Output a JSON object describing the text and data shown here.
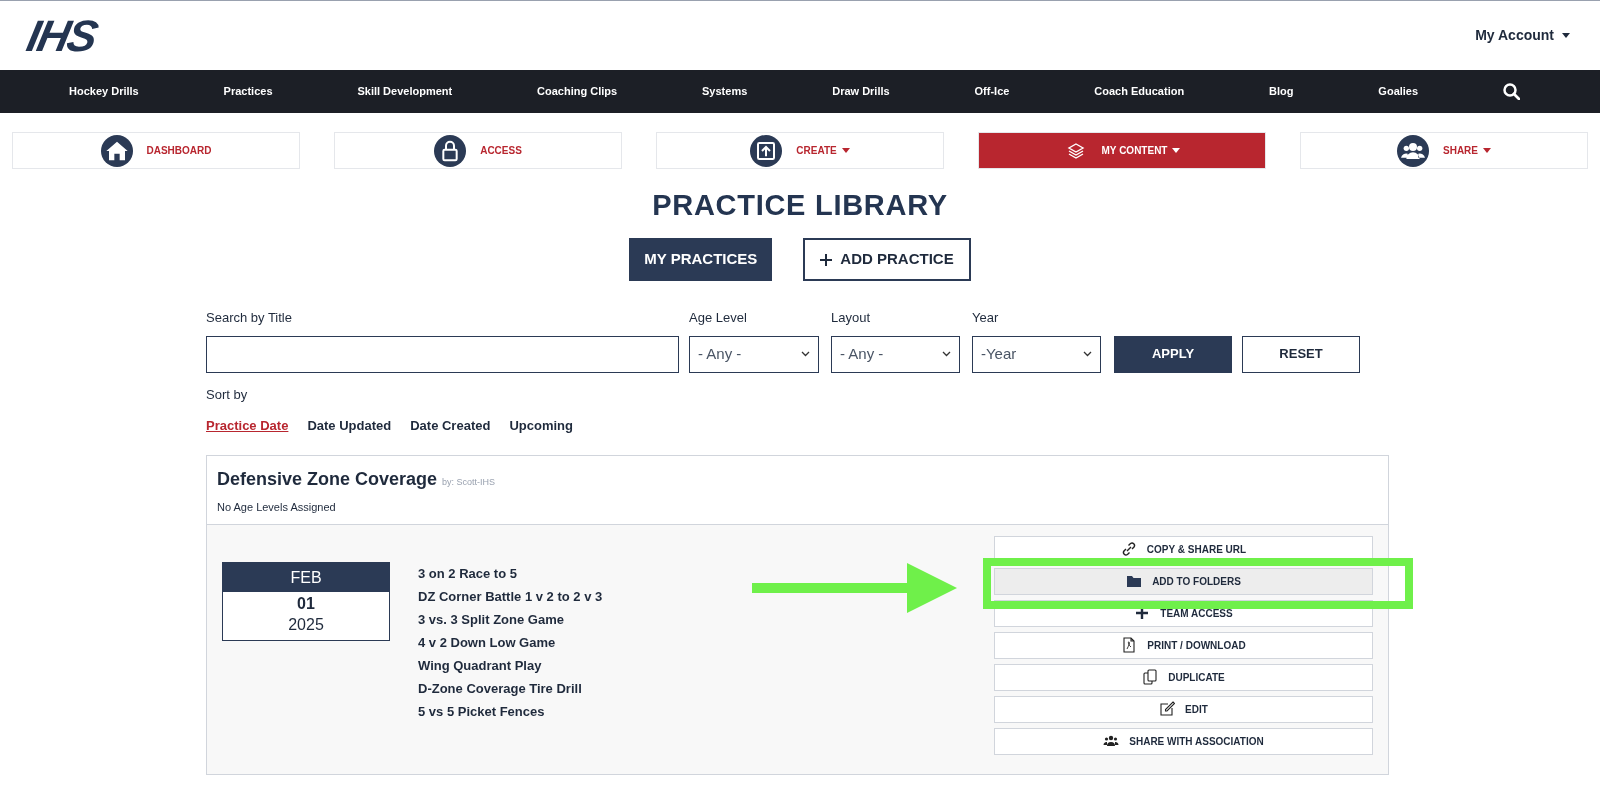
{
  "header": {
    "logo": "IHS",
    "account": "My Account"
  },
  "nav": [
    "Hockey Drills",
    "Practices",
    "Skill Development",
    "Coaching Clips",
    "Systems",
    "Draw Drills",
    "Off-Ice",
    "Coach Education",
    "Blog",
    "Goalies"
  ],
  "tiles": [
    {
      "kind": "home",
      "label": "DASHBOARD",
      "caret": false,
      "selected": false
    },
    {
      "kind": "lock",
      "label": "ACCESS",
      "caret": false,
      "selected": false
    },
    {
      "kind": "upload",
      "label": "CREATE",
      "caret": true,
      "selected": false
    },
    {
      "kind": "layers",
      "label": "MY CONTENT",
      "caret": true,
      "selected": true
    },
    {
      "kind": "people",
      "label": "SHARE",
      "caret": true,
      "selected": false
    }
  ],
  "page_title": "PRACTICE LIBRARY",
  "view_buttons": [
    {
      "label": "MY PRACTICES",
      "selected": true,
      "plus": false
    },
    {
      "label": "ADD PRACTICE",
      "selected": false,
      "plus": true
    }
  ],
  "filters": {
    "search": {
      "label": "Search by Title"
    },
    "selects": [
      {
        "label": "Age Level",
        "value": "- Any -"
      },
      {
        "label": "Layout",
        "value": "- Any -"
      },
      {
        "label": "Year",
        "value": "-Year"
      }
    ],
    "apply": "APPLY",
    "reset": "RESET"
  },
  "sort": {
    "label": "Sort by",
    "options": [
      {
        "label": "Practice Date",
        "selected": true
      },
      {
        "label": "Date Updated",
        "selected": false
      },
      {
        "label": "Date Created",
        "selected": false
      },
      {
        "label": "Upcoming",
        "selected": false
      }
    ]
  },
  "practice": {
    "title": "Defensive Zone Coverage",
    "author": "by: Scott-IHS",
    "age_levels": "No Age Levels Assigned",
    "date": {
      "month": "FEB",
      "day": "01",
      "year": "2025"
    },
    "drills": [
      "3 on 2 Race to 5",
      "DZ Corner Battle 1 v 2 to 2 v 3",
      "3 vs. 3 Split Zone Game",
      "4 v 2 Down Low Game",
      "Wing Quadrant Play",
      "D-Zone Coverage Tire Drill",
      "5 vs 5 Picket Fences"
    ],
    "actions": [
      {
        "kind": "link",
        "label": "COPY & SHARE URL",
        "highlighted": false,
        "callout": false
      },
      {
        "kind": "folder",
        "label": "ADD TO FOLDERS",
        "highlighted": true,
        "callout": true
      },
      {
        "kind": "plus",
        "label": "TEAM ACCESS",
        "highlighted": false,
        "callout": false
      },
      {
        "kind": "pdf",
        "label": "PRINT / DOWNLOAD",
        "highlighted": false,
        "callout": false
      },
      {
        "kind": "copy",
        "label": "DUPLICATE",
        "highlighted": false,
        "callout": false
      },
      {
        "kind": "edit",
        "label": "EDIT",
        "highlighted": false,
        "callout": false
      },
      {
        "kind": "people",
        "label": "SHARE WITH ASSOCIATION",
        "highlighted": false,
        "callout": false
      }
    ]
  }
}
